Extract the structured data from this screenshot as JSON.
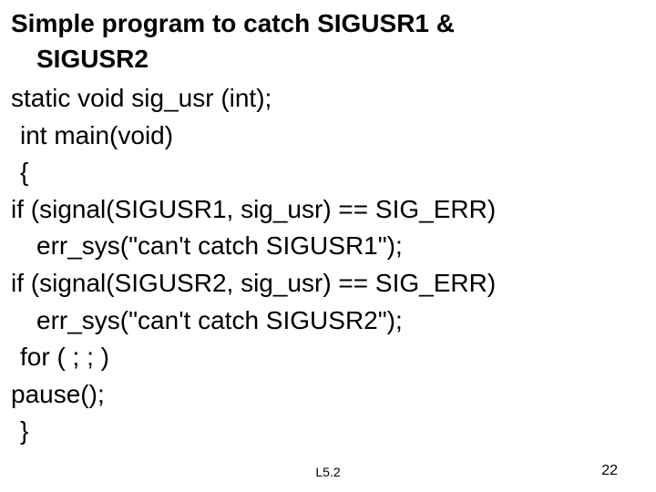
{
  "slide": {
    "title_line1": "Simple program to catch  SIGUSR1 &",
    "title_line2": "SIGUSR2",
    "lines": [
      {
        "indent": "ind0",
        "text": "static void sig_usr (int);"
      },
      {
        "indent": "ind1",
        "text": "int main(void)"
      },
      {
        "indent": "ind1",
        "text": "{"
      },
      {
        "indent": "ind0",
        "text": "if (signal(SIGUSR1, sig_usr) == SIG_ERR)"
      },
      {
        "indent": "ind2",
        "text": "err_sys(\"can't catch SIGUSR1\");"
      },
      {
        "indent": "ind0",
        "text": "if (signal(SIGUSR2, sig_usr) == SIG_ERR)"
      },
      {
        "indent": "ind2",
        "text": "err_sys(\"can't catch SIGUSR2\");"
      },
      {
        "indent": "ind1",
        "text": "for ( ; ; )"
      },
      {
        "indent": "ind0",
        "text": "pause();"
      },
      {
        "indent": "ind1",
        "text": "}"
      }
    ],
    "footer_center": "L5.2",
    "footer_right": "22"
  }
}
